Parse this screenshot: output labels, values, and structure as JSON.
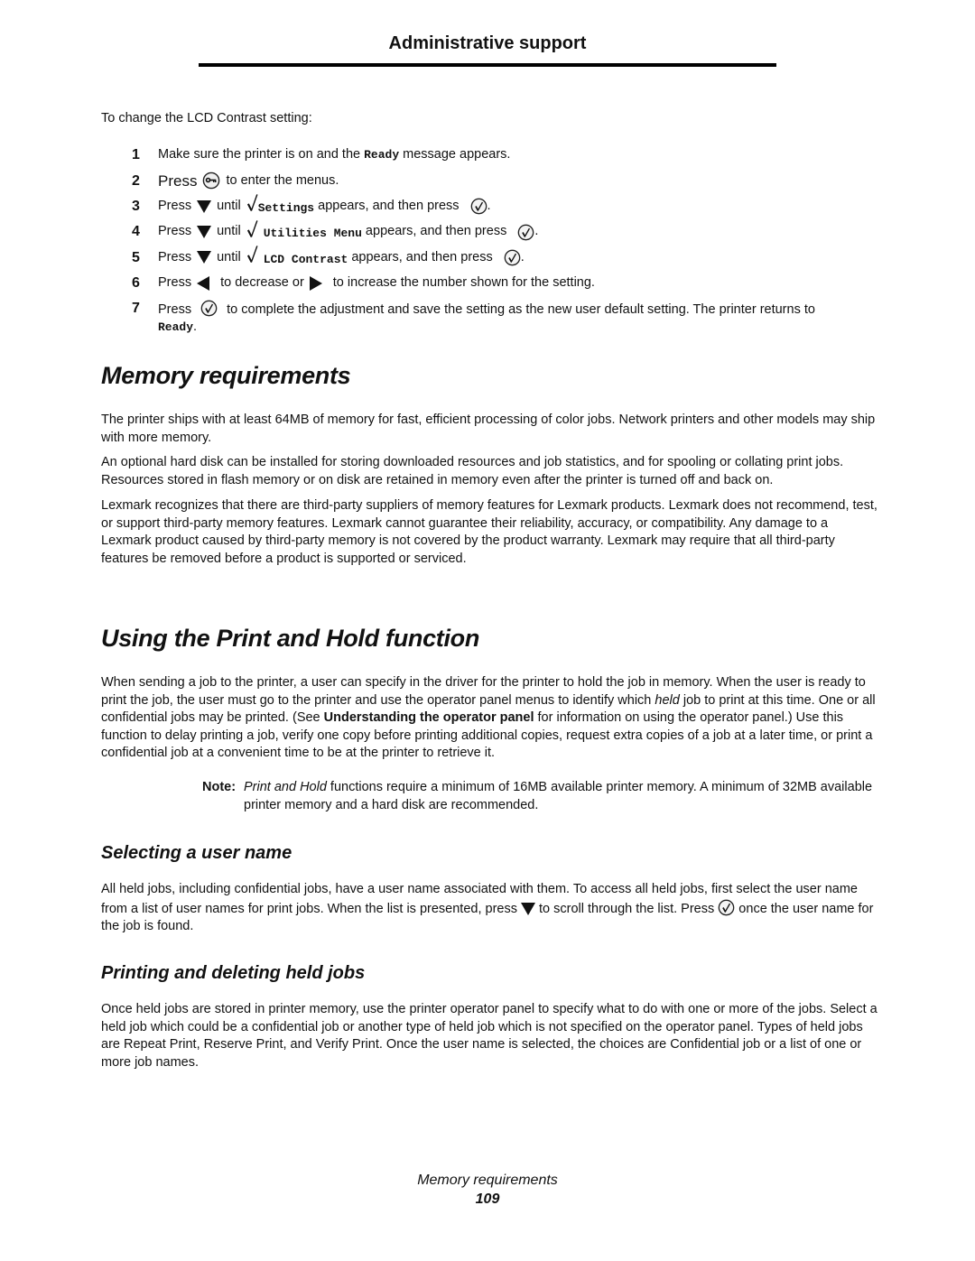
{
  "header": {
    "title": "Administrative support"
  },
  "lcd_section": {
    "intro": "To change the LCD Contrast setting:",
    "steps": [
      {
        "num": "1",
        "t1": "Make sure the printer is on and the ",
        "code": "Ready",
        "t2": " message appears."
      },
      {
        "num": "2",
        "press": "Press",
        "icon": "menu-key-icon",
        "t1": "to enter the menus."
      },
      {
        "num": "3",
        "press": "Press",
        "until": "until",
        "code": "Settings",
        "t1": " appears, and then press",
        "end": "."
      },
      {
        "num": "4",
        "press": "Press",
        "until": "until",
        "code": "Utilities Menu",
        "t1": " appears, and then press",
        "end": "."
      },
      {
        "num": "5",
        "press": "Press",
        "until": "until",
        "code": "LCD Contrast",
        "t1": " appears, and then press",
        "end": "."
      },
      {
        "num": "6",
        "press": "Press",
        "t1": "to decrease or",
        "t2": "to increase the number shown for the setting."
      },
      {
        "num": "7",
        "press": "Press",
        "t1": "to complete the adjustment and save the setting as the new user default setting. The printer returns to",
        "code": "Ready",
        "end": "."
      }
    ]
  },
  "memory_section": {
    "title": "Memory requirements",
    "paragraphs": [
      "The printer ships with at least 64MB of memory for fast, efficient processing of color jobs. Network printers and other models may ship with more memory.",
      "An optional hard disk can be installed for storing downloaded resources and job statistics, and for spooling or collating print jobs. Resources stored in flash memory or on disk are retained in memory even after the printer is turned off and back on.",
      "Lexmark recognizes that there are third-party suppliers of memory features for Lexmark products. Lexmark does not recommend, test, or support third-party memory features. Lexmark cannot guarantee their reliability, accuracy, or compatibility. Any damage to a Lexmark product caused by third-party memory is not covered by the product warranty. Lexmark may require that all third-party features be removed before a product is supported or serviced."
    ]
  },
  "print_hold_section": {
    "title": "Using the Print and Hold function",
    "para": {
      "p1": "When sending a job to the printer, a user can specify in the driver for the printer to hold the job in memory. When the user is ready to print the job, the user must go to the printer and use the operator panel menus to identify which ",
      "held": "held",
      "p2": " job to print at this time. One or all confidential jobs may be printed. (See ",
      "link": "Understanding the operator panel",
      "p3": " for information on using the operator panel.) Use this function to delay printing a job, verify one copy before printing additional copies, request extra copies of a job at a later time, or print a confidential job at a convenient time to be at the printer to retrieve it."
    },
    "note": {
      "label": "Note:",
      "italic": "Print and Hold",
      "text": " functions require a minimum of 16MB available printer memory. A minimum of 32MB available printer memory and a hard disk are recommended."
    }
  },
  "selecting_section": {
    "title": "Selecting a user name",
    "p1": "All held jobs, including confidential jobs, have a user name associated with them. To access all held jobs, first select the user name from a list of user names for print jobs. When the list is presented, press ",
    "p2": " to scroll through the list. Press ",
    "p3": " once the user name for the job is found."
  },
  "printing_section": {
    "title": "Printing and deleting held jobs",
    "para": "Once held jobs are stored in printer memory, use the printer operator panel to specify what to do with one or more of the jobs. Select a held job which could be a confidential job or another type of held job which is not specified on the operator panel. Types of held jobs are Repeat Print, Reserve Print, and Verify Print. Once the user name is selected, the choices are Confidential job or a list of one or more job names."
  },
  "footer": {
    "title": "Memory requirements",
    "page": "109"
  }
}
